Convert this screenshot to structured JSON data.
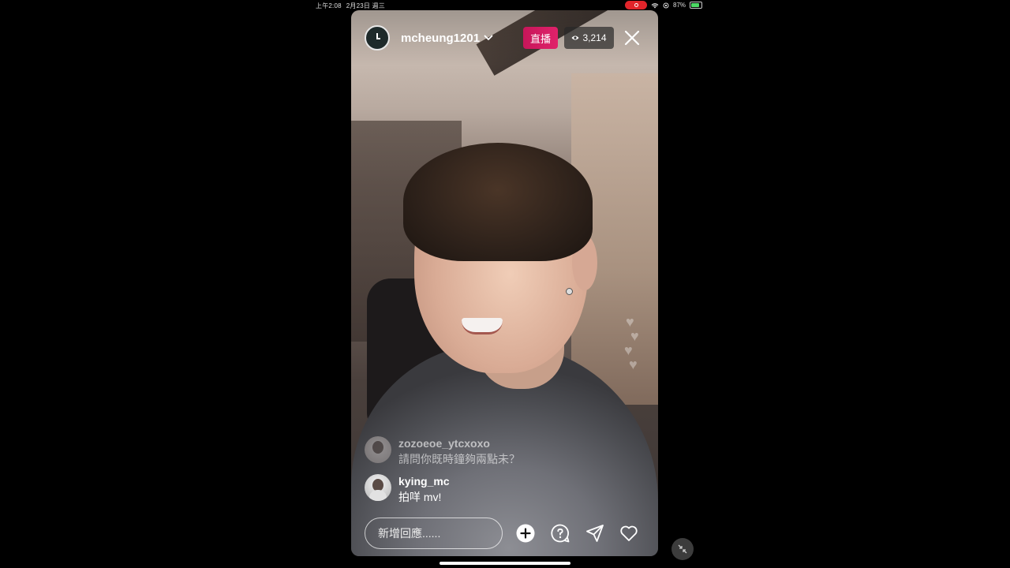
{
  "status_bar": {
    "time": "上午2:08",
    "date": "2月23日 週三",
    "battery": "87%"
  },
  "live": {
    "username": "mcheung1201",
    "live_label": "直播",
    "viewer_count": "3,214"
  },
  "comments": [
    {
      "user": "zozoeoe_ytcxoxo",
      "message": "請問你既時鐘夠兩點未？"
    },
    {
      "user": "kying_mc",
      "message": "拍咩 mv!"
    }
  ],
  "input": {
    "placeholder": "新增回應......"
  },
  "icons": {
    "avatar": "clock-avatar-icon",
    "dropdown": "chevron-down-icon",
    "viewers": "eye-icon",
    "close": "close-icon",
    "add": "plus-circle-icon",
    "question": "question-bubble-icon",
    "share": "send-icon",
    "like": "heart-icon",
    "minimize": "minimize-icon"
  },
  "colors": {
    "live_badge": "#d81b60",
    "recording": "#e0242a",
    "battery": "#4cd964"
  }
}
